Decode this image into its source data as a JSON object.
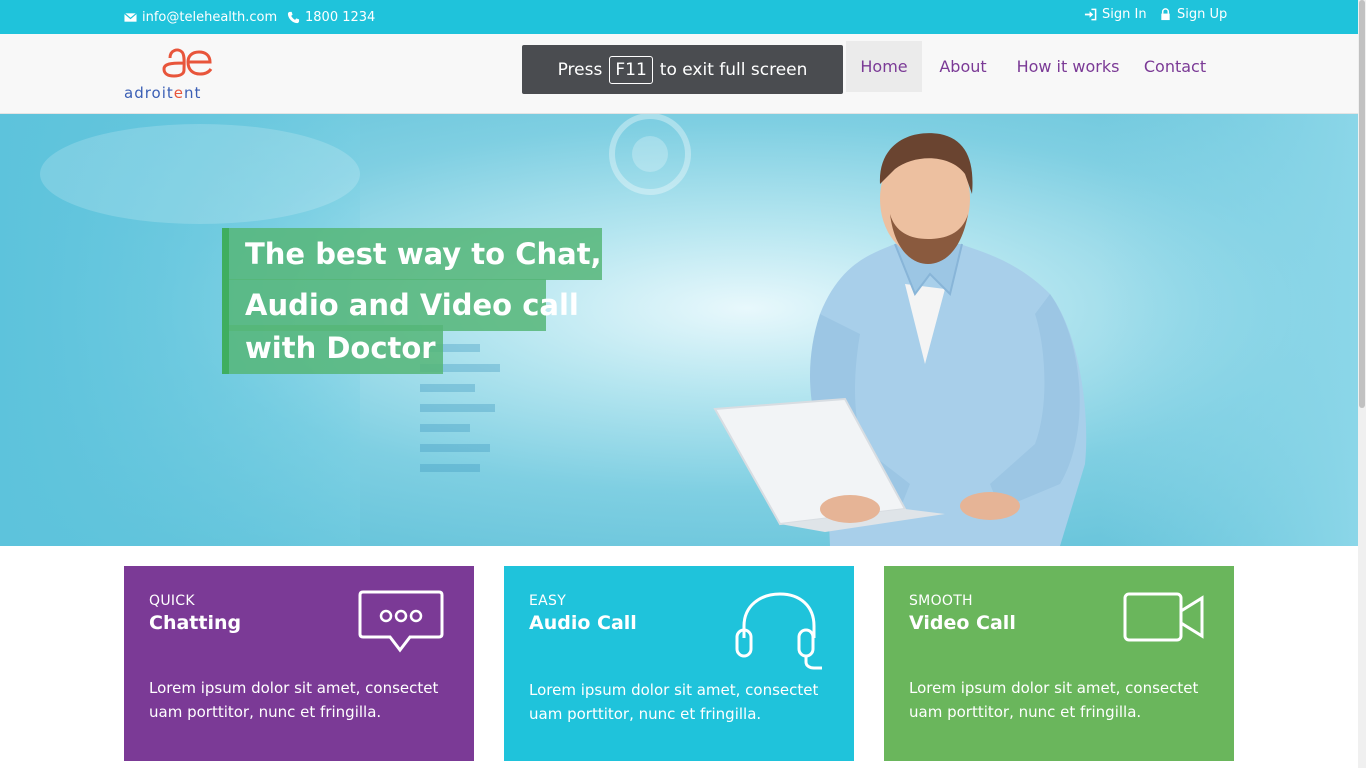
{
  "topbar": {
    "email": "info@telehealth.com",
    "phone": "1800 1234",
    "sign_in": "Sign In",
    "sign_up": "Sign Up"
  },
  "header": {
    "logo_text_part1": "adroit",
    "logo_text_part2": "e",
    "logo_text_part3": "nt",
    "fullscreen_press": "Press",
    "fullscreen_key": "F11",
    "fullscreen_rest": "to exit full screen",
    "nav": {
      "home": "Home",
      "about": "About",
      "how_it_works": "How it works",
      "contact": "Contact"
    }
  },
  "hero": {
    "line1": "The best way to Chat,",
    "line2": "Audio and Video call",
    "line3": "with Doctor"
  },
  "features": [
    {
      "kicker": "QUICK",
      "title": "Chatting",
      "description_line1": "Lorem ipsum dolor sit amet, consectet",
      "description_line2": "uam porttitor, nunc et fringilla.",
      "color": "#7b3a96",
      "icon": "chat-bubble-icon"
    },
    {
      "kicker": "EASY",
      "title": "Audio Call",
      "description_line1": "Lorem ipsum dolor sit amet, consectet",
      "description_line2": "uam porttitor, nunc et fringilla.",
      "color": "#1fc3db",
      "icon": "headset-icon"
    },
    {
      "kicker": "SMOOTH",
      "title": "Video Call",
      "description_line1": "Lorem ipsum dolor sit amet, consectet",
      "description_line2": "uam porttitor, nunc et fringilla.",
      "color": "#6ab65c",
      "icon": "video-camera-icon"
    }
  ],
  "colors": {
    "topbar": "#1fc3db",
    "nav_text": "#7b3a96",
    "headline_bg": "#56b678"
  }
}
